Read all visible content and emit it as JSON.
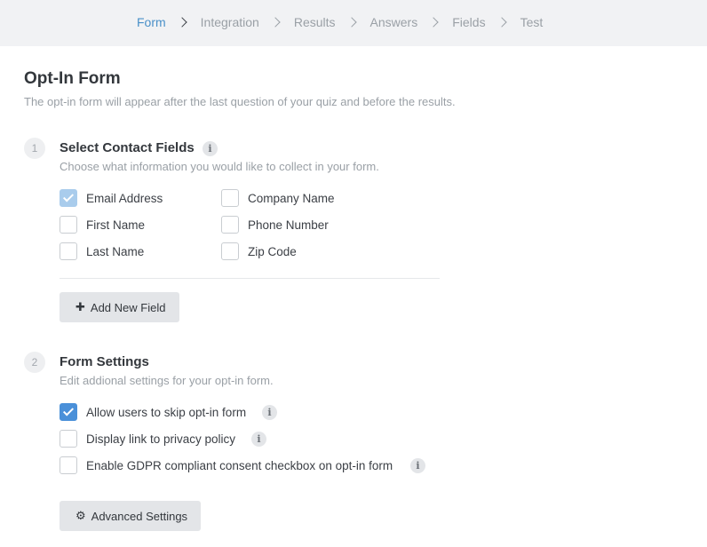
{
  "breadcrumb": [
    {
      "label": "Form",
      "active": true
    },
    {
      "label": "Integration",
      "active": false
    },
    {
      "label": "Results",
      "active": false
    },
    {
      "label": "Answers",
      "active": false
    },
    {
      "label": "Fields",
      "active": false
    },
    {
      "label": "Test",
      "active": false
    }
  ],
  "page": {
    "title": "Opt-In Form",
    "subtitle": "The opt-in form will appear after the last question of your quiz and before the results."
  },
  "contact_fields": {
    "step": "1",
    "title": "Select Contact Fields",
    "subtitle": "Choose what information you would like to collect in your form.",
    "fields": [
      {
        "label": "Email Address",
        "checked": true,
        "disabled": true
      },
      {
        "label": "First Name",
        "checked": false
      },
      {
        "label": "Last Name",
        "checked": false
      },
      {
        "label": "Company Name",
        "checked": false
      },
      {
        "label": "Phone Number",
        "checked": false
      },
      {
        "label": "Zip Code",
        "checked": false
      }
    ],
    "add_button": "Add New Field"
  },
  "form_settings": {
    "step": "2",
    "title": "Form Settings",
    "subtitle": "Edit addional settings for your opt-in form.",
    "options": [
      {
        "label": "Allow users to skip opt-in form",
        "checked": true
      },
      {
        "label": "Display link to privacy policy",
        "checked": false
      },
      {
        "label": "Enable GDPR compliant consent checkbox on opt-in form",
        "checked": false
      }
    ],
    "advanced_button": "Advanced Settings"
  },
  "icons": {
    "info": "info-icon",
    "plus": "plus-icon",
    "gear": "gear-icon",
    "chevron": "chevron-right-icon"
  },
  "colors": {
    "accent": "#4a90d9",
    "active_crumb": "#4a90c8",
    "topbar_bg": "#f1f2f4"
  }
}
